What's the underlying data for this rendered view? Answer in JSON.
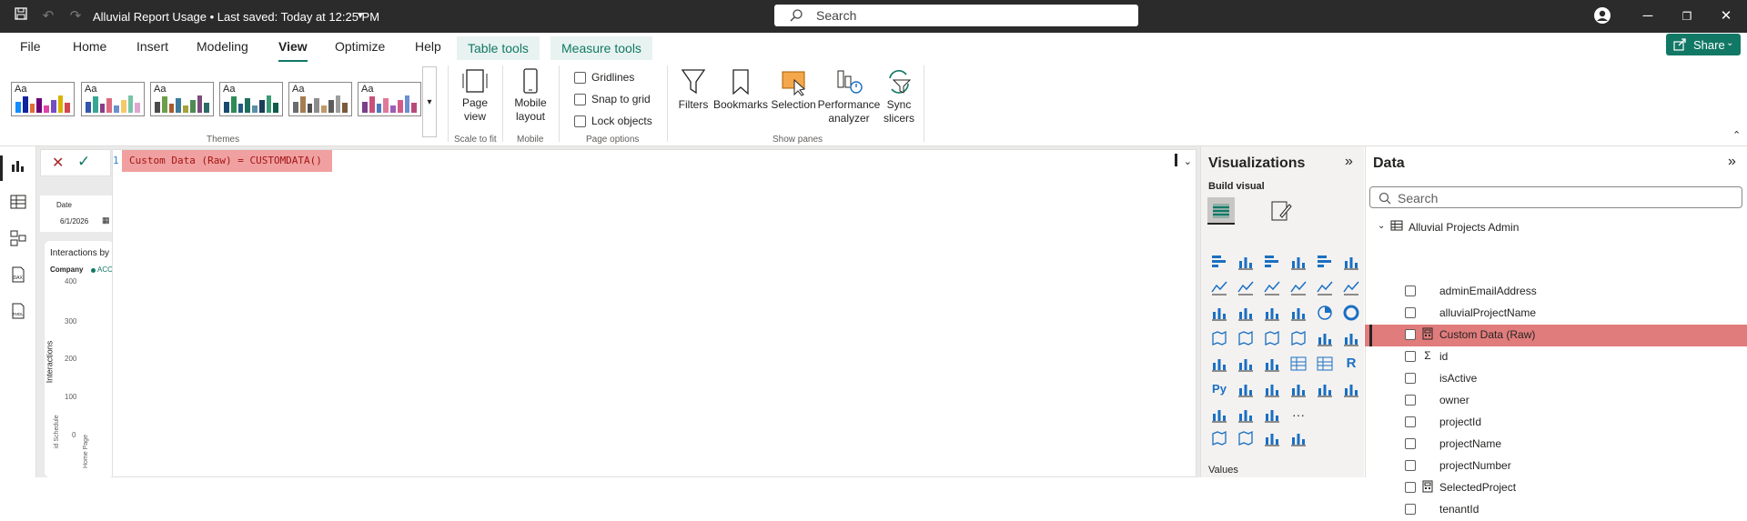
{
  "titlebar": {
    "title": "Alluvial Report Usage • Last saved: Today at 12:25 PM",
    "search_placeholder": "Search"
  },
  "menu": {
    "tabs": [
      "File",
      "Home",
      "Insert",
      "Modeling",
      "View",
      "Optimize",
      "Help"
    ],
    "active": "View",
    "context_tabs": [
      "Table tools",
      "Measure tools"
    ],
    "share_label": "Share"
  },
  "ribbon": {
    "theme_label_text": "Aa",
    "themes_group": "Themes",
    "theme_palettes": [
      [
        "#118dff",
        "#12239e",
        "#e66c37",
        "#6b007b",
        "#e044a7",
        "#744ec2",
        "#d9b300",
        "#d64550"
      ],
      [
        "#3257a8",
        "#37a794",
        "#8b3d88",
        "#dd6b7f",
        "#6b91c9",
        "#f5c869",
        "#77c4a8",
        "#dea6cf"
      ],
      [
        "#4b4b4b",
        "#6c9f4a",
        "#aa5a2c",
        "#3d7a9e",
        "#a8a13a",
        "#4e8b53",
        "#7b4b7b",
        "#2d6a6a"
      ],
      [
        "#1a4a6e",
        "#2e8b57",
        "#245a80",
        "#1f6f5c",
        "#5b8ea8",
        "#1b3c5a",
        "#3a9a72",
        "#0f5c4a"
      ],
      [
        "#6b6b6b",
        "#a67c52",
        "#4f4f4f",
        "#8c8c8c",
        "#c19a6b",
        "#5c5c5c",
        "#9e9e9e",
        "#7b5b3a"
      ],
      [
        "#7a3f8a",
        "#c94f7c",
        "#4b7bbd",
        "#e07a9a",
        "#9b5fb5",
        "#d45a8a",
        "#6b8fd0",
        "#b84a7a"
      ]
    ],
    "scale": {
      "label_line1": "Page",
      "label_line2": "view",
      "group": "Scale to fit"
    },
    "mobile": {
      "label_line1": "Mobile",
      "label_line2": "layout",
      "group": "Mobile"
    },
    "page_options": {
      "gridlines": "Gridlines",
      "snap": "Snap to grid",
      "lock": "Lock objects",
      "group": "Page options"
    },
    "show_panes": {
      "group": "Show panes",
      "filters": "Filters",
      "bookmarks": "Bookmarks",
      "selection": "Selection",
      "performance_1": "Performance",
      "performance_2": "analyzer",
      "sync_1": "Sync",
      "sync_2": "slicers"
    }
  },
  "formula": {
    "line_number": "1",
    "text": "Custom Data (Raw) = CUSTOMDATA()"
  },
  "canvas": {
    "date_label": "Date",
    "date_value": "6/1/2026",
    "chart_title": "Interactions by",
    "legend_label": "Company",
    "legend_item": "ACC",
    "y_label": "Interactions",
    "y_ticks": [
      "400",
      "300",
      "200",
      "100",
      "0"
    ],
    "x_ticks": [
      "id Schedule",
      "Home Page"
    ]
  },
  "visualizations": {
    "title": "Visualizations",
    "build_visual": "Build visual",
    "values_label": "Values",
    "r_label": "R",
    "py_label": "Py",
    "more_label": "···"
  },
  "data_pane": {
    "title": "Data",
    "search_placeholder": "Search",
    "table_name": "Alluvial Projects Admin",
    "fields": [
      {
        "name": "adminEmailAddress",
        "type": ""
      },
      {
        "name": "alluvialProjectName",
        "type": ""
      },
      {
        "name": "Custom Data (Raw)",
        "type": "calc",
        "selected": true
      },
      {
        "name": "id",
        "type": "sigma"
      },
      {
        "name": "isActive",
        "type": ""
      },
      {
        "name": "owner",
        "type": ""
      },
      {
        "name": "projectId",
        "type": ""
      },
      {
        "name": "projectName",
        "type": ""
      },
      {
        "name": "projectNumber",
        "type": ""
      },
      {
        "name": "SelectedProject",
        "type": "calc"
      },
      {
        "name": "tenantId",
        "type": ""
      }
    ]
  },
  "colors": {
    "accent": "#117865",
    "highlight": "#e17c7c",
    "formula_highlight": "#f0a0a0"
  }
}
